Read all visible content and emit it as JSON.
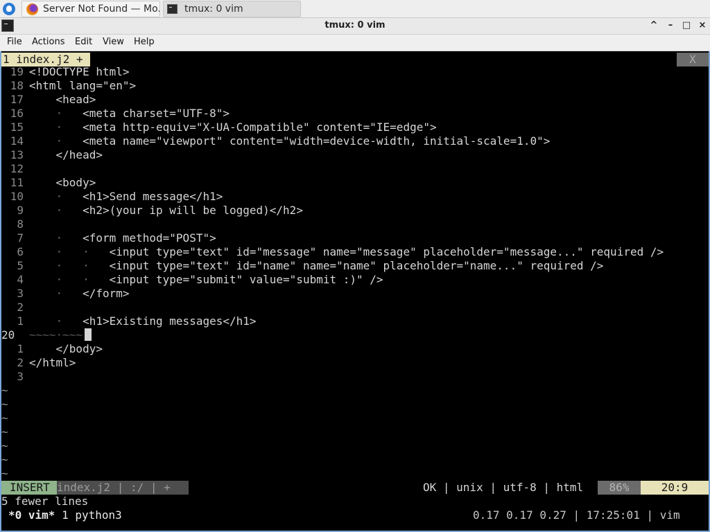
{
  "taskbar": {
    "tasks": [
      {
        "label": "Server Not Found — Mo...",
        "icon": "firefox-icon"
      },
      {
        "label": "tmux: 0 vim",
        "icon": "terminal-icon"
      }
    ]
  },
  "window": {
    "title": "tmux: 0 vim",
    "buttons": {
      "shade": "^",
      "minimize": "–",
      "maximize": "□",
      "close": "×"
    }
  },
  "menu": [
    "File",
    "Actions",
    "Edit",
    "View",
    "Help"
  ],
  "vim": {
    "tab_label": "1 index.j2 +",
    "tab_close": "X",
    "lines": [
      {
        "num": "19",
        "indent": 0,
        "text": "<!DOCTYPE html>"
      },
      {
        "num": "18",
        "indent": 0,
        "text": "<html lang=\"en\">"
      },
      {
        "num": "17",
        "indent": 1,
        "text": "<head>"
      },
      {
        "num": "16",
        "indent": 2,
        "text": "<meta charset=\"UTF-8\">"
      },
      {
        "num": "15",
        "indent": 2,
        "text": "<meta http-equiv=\"X-UA-Compatible\" content=\"IE=edge\">"
      },
      {
        "num": "14",
        "indent": 2,
        "text": "<meta name=\"viewport\" content=\"width=device-width, initial-scale=1.0\">"
      },
      {
        "num": "13",
        "indent": 1,
        "text": "</head>"
      },
      {
        "num": "12",
        "indent": 0,
        "text": ""
      },
      {
        "num": "11",
        "indent": 1,
        "text": "<body>"
      },
      {
        "num": "10",
        "indent": 2,
        "text": "<h1>Send message</h1>"
      },
      {
        "num": "9",
        "indent": 2,
        "text": "<h2>(your ip will be logged)</h2>"
      },
      {
        "num": "8",
        "indent": 0,
        "text": ""
      },
      {
        "num": "7",
        "indent": 2,
        "text": "<form method=\"POST\">"
      },
      {
        "num": "6",
        "indent": 3,
        "text": "<input type=\"text\" id=\"message\" name=\"message\" placeholder=\"message...\" required />"
      },
      {
        "num": "5",
        "indent": 3,
        "text": "<input type=\"text\" id=\"name\" name=\"name\" placeholder=\"name...\" required />"
      },
      {
        "num": "4",
        "indent": 3,
        "text": "<input type=\"submit\" value=\"submit :)\" />"
      },
      {
        "num": "3",
        "indent": 2,
        "text": "</form>"
      },
      {
        "num": "2",
        "indent": 0,
        "text": ""
      },
      {
        "num": "1",
        "indent": 2,
        "text": "<h1>Existing messages</h1>"
      },
      {
        "num": "20",
        "indent": 0,
        "text": "~~~~·~~~"
      },
      {
        "num": "1",
        "indent": 1,
        "text": "</body>"
      },
      {
        "num": "2",
        "indent": 0,
        "text": "</html>"
      },
      {
        "num": "3",
        "indent": 0,
        "text": ""
      }
    ],
    "tilde_count": 7,
    "status": {
      "mode": "INSERT",
      "file": "index.j2 | :/ | +",
      "right": "OK | unix | utf-8 | html",
      "percent": "86%",
      "position": "20:9"
    },
    "message": "5 fewer lines"
  },
  "tmux": {
    "left_active": "*0 vim*",
    "left_other": " 1 python3",
    "right": "0.17 0.17 0.27 | 17:25:01 | vim"
  },
  "colors": {
    "tab_active": "#e8e2b8",
    "mode_green": "#8fb38a",
    "window_border": "#7aa7d8"
  }
}
